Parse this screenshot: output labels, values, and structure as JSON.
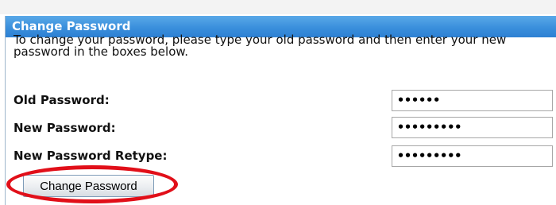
{
  "panel": {
    "title": "Change Password",
    "instructions": "To change your password, please type your old password and then enter your new password in the boxes below."
  },
  "form": {
    "old_password": {
      "label": "Old Password:",
      "value": "••••••"
    },
    "new_password": {
      "label": "New Password:",
      "value": "•••••••••"
    },
    "new_password_retype": {
      "label": "New Password Retype:",
      "value": "•••••••••"
    },
    "submit_label": "Change Password"
  },
  "colors": {
    "header_blue": "#3a8fdc",
    "highlight_red": "#e10f19"
  }
}
